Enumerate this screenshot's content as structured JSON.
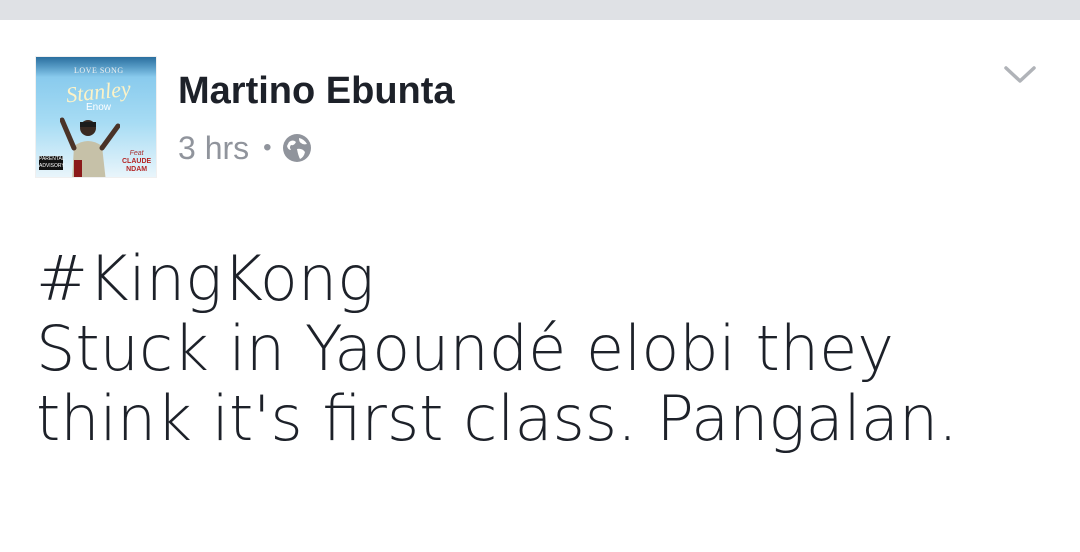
{
  "post": {
    "author": "Martino Ebunta",
    "time": "3 hrs",
    "separator": "•",
    "privacy_icon": "globe-icon",
    "menu_icon": "chevron-down-icon",
    "avatar": {
      "top_text": "LOVE SONG",
      "script_text": "Stanley",
      "sub_text": "Enow",
      "feat_label": "Feat",
      "feat_name_1": "CLAUDE",
      "feat_name_2": "NDAM"
    },
    "lines": [
      "#KingKong",
      "Stuck in Yaoundé elobi they",
      "think it's first class. Pangalan."
    ]
  },
  "colors": {
    "text_primary": "#1d2129",
    "text_secondary": "#90949c",
    "top_strip": "#dfe1e5"
  }
}
